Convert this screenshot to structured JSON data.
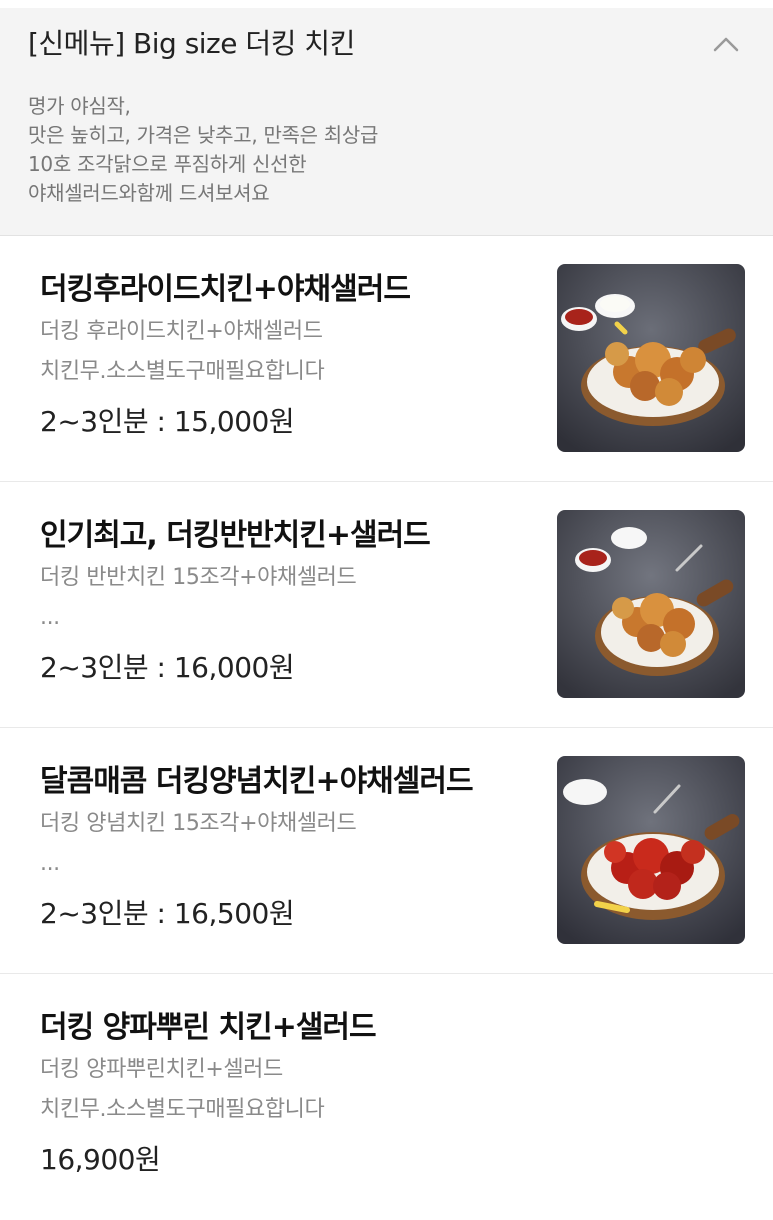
{
  "category": {
    "title": "[신메뉴] Big size 더킹 치킨",
    "collapse_icon": "chevron-up-icon",
    "description": [
      "명가 야심작,",
      "맛은 높히고, 가격은 낮추고, 만족은 최상급",
      "10호 조각닭으로 푸짐하게 신선한",
      "야채셀러드와함께 드셔보셔요"
    ]
  },
  "items": [
    {
      "name": "더킹후라이드치킨+야채샐러드",
      "desc_line1": "더킹 후라이드치킨+야채셀러드",
      "desc_line2": "치킨무.소스별도구매필요합니다",
      "price": "2~3인분 : 15,000원",
      "photo": "fried-chicken-photo"
    },
    {
      "name": "인기최고, 더킹반반치킨+샐러드",
      "desc_line1": "더킹 반반치킨 15조각+야채셀러드",
      "desc_line2": "...",
      "price": "2~3인분 : 16,000원",
      "photo": "half-half-chicken-photo"
    },
    {
      "name": "달콤매콤 더킹양념치킨+야채셀러드",
      "desc_line1": "더킹 양념치킨 15조각+야채셀러드",
      "desc_line2": "...",
      "price": "2~3인분 : 16,500원",
      "photo": "seasoned-chicken-photo"
    },
    {
      "name": "더킹 양파뿌린 치킨+샐러드",
      "desc_line1": "더킹 양파뿌린치킨+셀러드",
      "desc_line2": "치킨무.소스별도구매필요합니다",
      "price": "16,900원"
    }
  ],
  "colors": {
    "header_bg": "#f4f4f4",
    "text_dark": "#111111",
    "text_gray": "#8a8a8a",
    "seasoned_red": "#c0281c",
    "fried_orange": "#d98a3a"
  }
}
